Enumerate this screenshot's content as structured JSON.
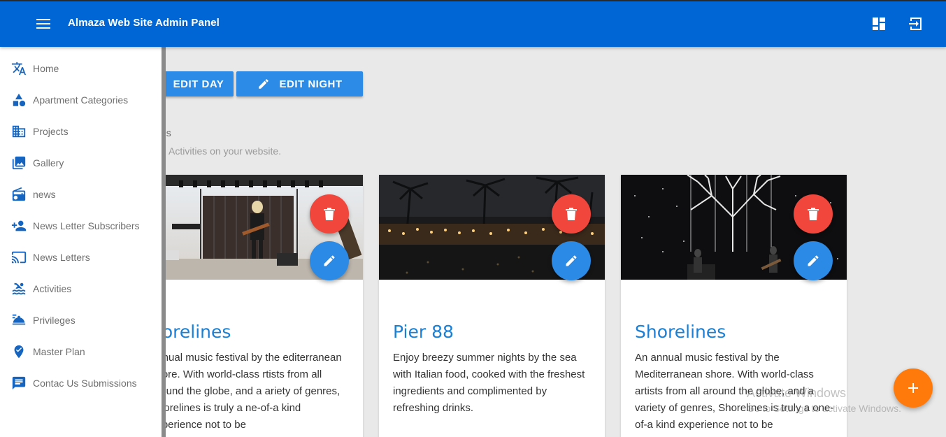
{
  "appbar": {
    "title": "Almaza Web Site Admin Panel"
  },
  "toolbar": {
    "edit_day_label": "EDIT DAY",
    "edit_night_label": "EDIT NIGHT"
  },
  "section": {
    "title": "es",
    "subtitle": "Activities on your website."
  },
  "sidebar": {
    "items": [
      {
        "label": "Home",
        "icon": "translate-icon"
      },
      {
        "label": "Apartment Categories",
        "icon": "category-icon"
      },
      {
        "label": "Projects",
        "icon": "business-icon"
      },
      {
        "label": "Gallery",
        "icon": "photo-library-icon"
      },
      {
        "label": "news",
        "icon": "radio-icon"
      },
      {
        "label": "News Letter Subscribers",
        "icon": "person-add-icon"
      },
      {
        "label": "News Letters",
        "icon": "cast-icon"
      },
      {
        "label": "Activities",
        "icon": "pool-icon"
      },
      {
        "label": "Privileges",
        "icon": "room-service-icon"
      },
      {
        "label": "Master Plan",
        "icon": "verified-place-icon"
      },
      {
        "label": "Contac Us Submissions",
        "icon": "chat-icon"
      }
    ]
  },
  "cards": [
    {
      "title": "horelines",
      "description": "annual music festival by the editerranean shore. With world-class rtists from all around the globe, and a ariety of genres, Shorelines is truly a ne-of-a kind experience not to be"
    },
    {
      "title": "Pier 88",
      "description": "Enjoy breezy summer nights by the sea with Italian food, cooked with the freshest ingredients and complimented by refreshing drinks."
    },
    {
      "title": "Shorelines",
      "description": "An annual music festival by the Mediterranean shore. With world-class artists from all around the globe, and a variety of genres, Shorelines is truly a one-of-a kind experience not to be"
    }
  ],
  "watermark": {
    "line1": "Activate Windows",
    "line2": "Go to Settings to activate Windows."
  },
  "colors": {
    "primary": "#0066d6",
    "accent_blue": "#2b8be6",
    "delete_red": "#f0463c",
    "add_orange": "#ff7a0a"
  }
}
